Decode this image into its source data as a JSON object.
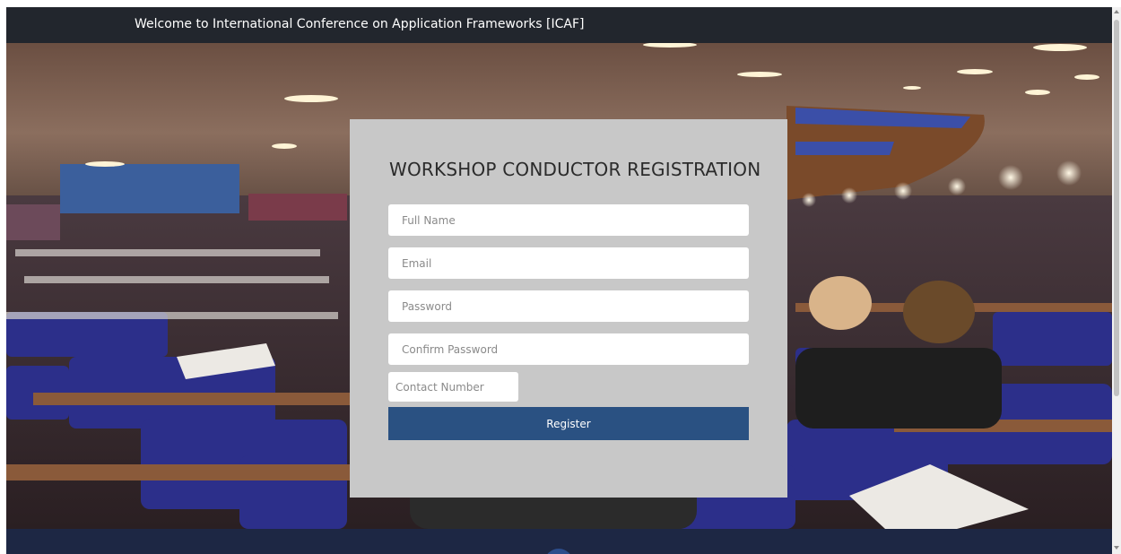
{
  "header": {
    "title": "Welcome to International Conference on Application Frameworks [ICAF]"
  },
  "hero": {
    "image": "conference-hall-photo"
  },
  "form": {
    "title": "WORKSHOP CONDUCTOR REGISTRATION",
    "fields": {
      "full_name": {
        "placeholder": "Full Name",
        "value": ""
      },
      "email": {
        "placeholder": "Email",
        "value": ""
      },
      "password": {
        "placeholder": "Password",
        "value": ""
      },
      "confirm_password": {
        "placeholder": "Confirm Password",
        "value": ""
      },
      "contact_number": {
        "placeholder": "Contact Number",
        "value": ""
      }
    },
    "register_label": "Register"
  },
  "colors": {
    "topbar": "#22262d",
    "card": "#c8c8c8",
    "button": "#2a5182",
    "bottom_strip": "#1d2744"
  }
}
